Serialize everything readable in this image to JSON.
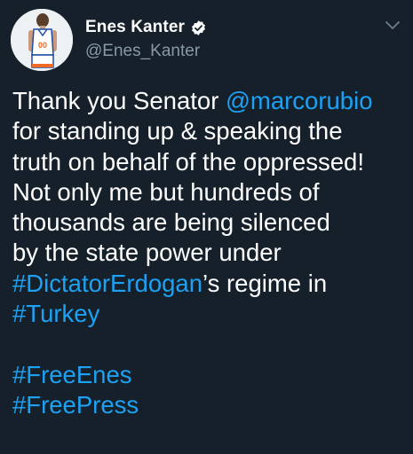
{
  "author": {
    "display_name": "Enes Kanter",
    "handle": "@Enes_Kanter",
    "avatar_jersey_number": "00"
  },
  "tweet": {
    "lines": [
      {
        "before": "Thank you Senator ",
        "link": "@marcorubio",
        "after": ""
      },
      {
        "before": "for standing up & speaking the",
        "link": "",
        "after": ""
      },
      {
        "before": "truth on behalf of the oppressed!",
        "link": "",
        "after": ""
      },
      {
        "before": "Not only me but hundreds of",
        "link": "",
        "after": ""
      },
      {
        "before": "thousands are being silenced",
        "link": "",
        "after": ""
      },
      {
        "before": "by the state power under",
        "link": "",
        "after": ""
      },
      {
        "before": "",
        "link": "#DictatorErdogan",
        "after": "’s regime in"
      },
      {
        "before": "",
        "link": "#Turkey",
        "after": ""
      }
    ],
    "hashtags": [
      "#FreeEnes",
      "#FreePress"
    ]
  },
  "colors": {
    "background": "#15202b",
    "text": "#ffffff",
    "secondary_text": "#8899a6",
    "link": "#1da1f2"
  },
  "icons": {
    "verified": "verified-badge-icon",
    "menu": "chevron-down-icon"
  }
}
